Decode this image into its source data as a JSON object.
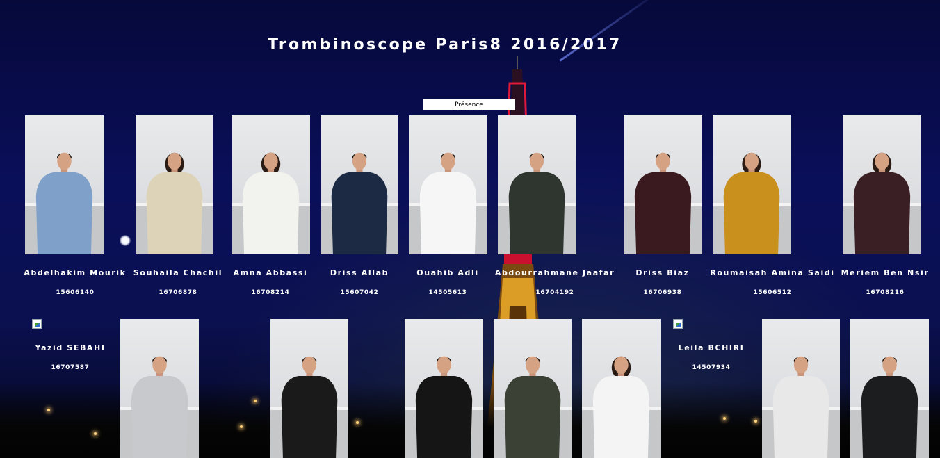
{
  "page": {
    "title": "Trombinoscope Paris8 2016/2017",
    "presence_button": "Présence"
  },
  "row1": [
    {
      "name": "Abdelhakim Mourik",
      "id": "15606140",
      "shirt": "#7fa0c8"
    },
    {
      "name": "Souhaila Chachil",
      "id": "16706878",
      "shirt": "#ddd3b8"
    },
    {
      "name": "Amna Abbassi",
      "id": "16708214",
      "shirt": "#f2f2ee"
    },
    {
      "name": "Driss Allab",
      "id": "15607042",
      "shirt": "#1c2a44"
    },
    {
      "name": "Ouahib Adli",
      "id": "14505613",
      "shirt": "#f6f6f6"
    },
    {
      "name": "Abdourrahmane Jaafar",
      "id": "16704192",
      "shirt": "#2f352f"
    },
    {
      "name": "Driss Biaz",
      "id": "16706938",
      "shirt": "#3a1a1e"
    },
    {
      "name": "Roumaisah Amina Saidi",
      "id": "15606512",
      "shirt": "#c9901e"
    },
    {
      "name": "Meriem Ben Nsir",
      "id": "16708216",
      "shirt": "#3a1f24"
    }
  ],
  "row2": [
    {
      "name": "Yazid SEBAHI",
      "id": "16707587"
    },
    {
      "name": "Leila BCHIRI",
      "id": "14507934"
    }
  ],
  "row2_photos": [
    {
      "shirt": "#c7c9cc"
    },
    {
      "shirt": "#1a1a1a"
    },
    {
      "shirt": "#151515"
    },
    {
      "shirt": "#3b4135"
    },
    {
      "shirt": "#f4f4f4"
    },
    {
      "shirt": "#e8e8e8"
    },
    {
      "shirt": "#1b1d1f"
    }
  ]
}
